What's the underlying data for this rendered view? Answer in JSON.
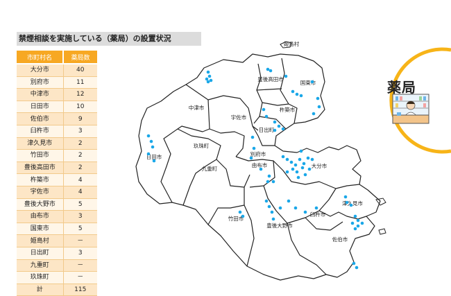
{
  "title": "禁煙相談を実施している（薬局）の設置状況",
  "table": {
    "headers": [
      "市町村名",
      "薬局数"
    ],
    "rows": [
      {
        "name": "大分市",
        "count": "40"
      },
      {
        "name": "別府市",
        "count": "11"
      },
      {
        "name": "中津市",
        "count": "12"
      },
      {
        "name": "日田市",
        "count": "10"
      },
      {
        "name": "佐伯市",
        "count": "9"
      },
      {
        "name": "臼杵市",
        "count": "3"
      },
      {
        "name": "津久見市",
        "count": "2"
      },
      {
        "name": "竹田市",
        "count": "2"
      },
      {
        "name": "豊後高田市",
        "count": "2"
      },
      {
        "name": "杵築市",
        "count": "4"
      },
      {
        "name": "宇佐市",
        "count": "4"
      },
      {
        "name": "豊後大野市",
        "count": "5"
      },
      {
        "name": "由布市",
        "count": "3"
      },
      {
        "name": "国東市",
        "count": "5"
      },
      {
        "name": "姫島村",
        "count": "－"
      },
      {
        "name": "日出町",
        "count": "3"
      },
      {
        "name": "九重町",
        "count": "－"
      },
      {
        "name": "玖珠町",
        "count": "－"
      },
      {
        "name": "計",
        "count": "115"
      }
    ]
  },
  "map": {
    "labels": {
      "himeshima": "姫島村",
      "bungotakada": "豊後高田市",
      "kunisaki": "国東市",
      "nakatsu": "中津市",
      "usa": "宇佐市",
      "kitsuki": "杵築市",
      "hiji": "日出町",
      "beppu": "別府市",
      "yufu": "由布市",
      "hita": "日田市",
      "kusu": "玖珠町",
      "kokonoe": "九重町",
      "oita": "大分市",
      "tsukumi": "津久見市",
      "usuki": "臼杵市",
      "taketa": "竹田市",
      "bungoono": "豊後大野市",
      "saiki": "佐伯市"
    },
    "marker_color": "#1aa7e8"
  },
  "badge": {
    "label": "薬局",
    "ring_color": "#f7b418"
  }
}
